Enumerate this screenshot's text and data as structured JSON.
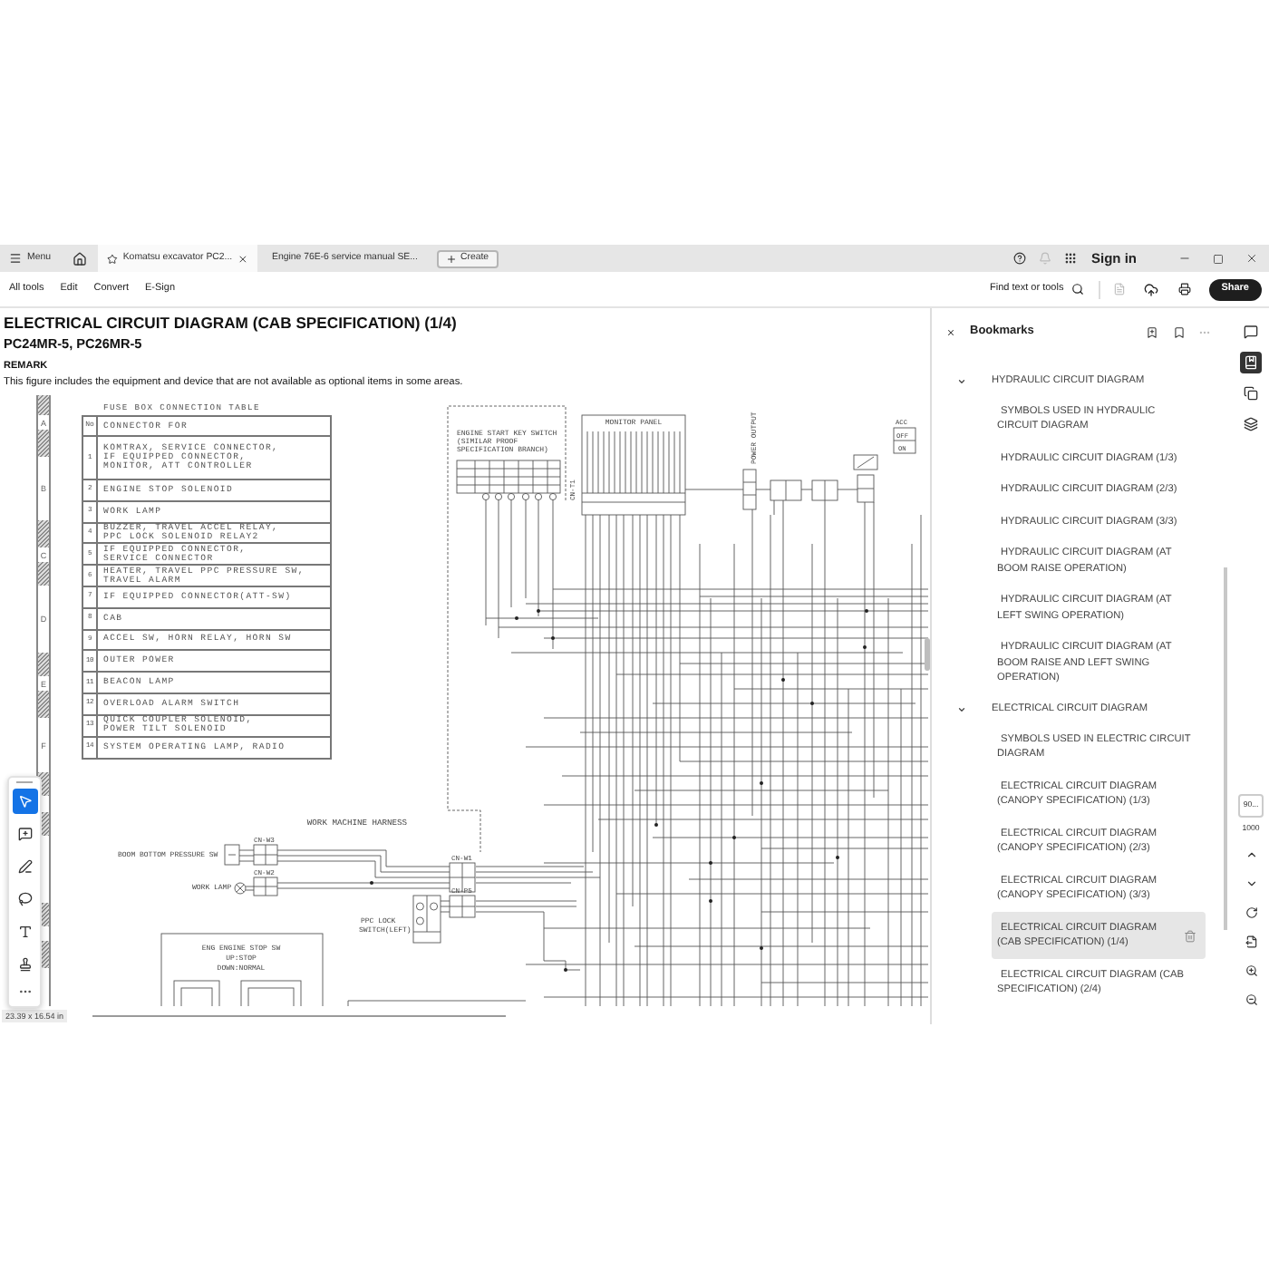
{
  "tabs_bar": {
    "menu": "Menu",
    "tabs": [
      {
        "title": "Komatsu excavator PC2...",
        "selected": true
      },
      {
        "title": "Engine 76E-6 service manual SE...",
        "selected": false
      }
    ],
    "create": "Create",
    "sign_in": "Sign in"
  },
  "toolbar": {
    "items": [
      "All tools",
      "Edit",
      "Convert",
      "E-Sign"
    ],
    "find": "Find text or tools",
    "share": "Share"
  },
  "document": {
    "title": "ELECTRICAL CIRCUIT DIAGRAM (CAB SPECIFICATION) (1/4)",
    "models": "PC24MR-5, PC26MR-5",
    "remark_heading": "REMARK",
    "remark": "This figure includes the equipment and device that are not available as optional items in some areas.",
    "zones": [
      "A",
      "B",
      "C",
      "D",
      "E",
      "F"
    ],
    "fuse_table": {
      "title": "FUSE BOX CONNECTION TABLE",
      "columns": [
        "No",
        "CONNECTOR FOR"
      ],
      "rows": [
        {
          "no": "1",
          "lines": [
            "KOMTRAX, SERVICE CONNECTOR,",
            "IF EQUIPPED CONNECTOR,",
            "MONITOR, ATT CONTROLLER"
          ]
        },
        {
          "no": "2",
          "lines": [
            "ENGINE STOP SOLENOID"
          ]
        },
        {
          "no": "3",
          "lines": [
            "WORK LAMP"
          ]
        },
        {
          "no": "4",
          "lines": [
            "BUZZER, TRAVEL ACCEL RELAY,",
            "PPC LOCK SOLENOID RELAY2"
          ]
        },
        {
          "no": "5",
          "lines": [
            "IF EQUIPPED CONNECTOR,",
            "SERVICE CONNECTOR"
          ]
        },
        {
          "no": "6",
          "lines": [
            "HEATER, TRAVEL PPC PRESSURE SW,",
            "TRAVEL ALARM"
          ]
        },
        {
          "no": "7",
          "lines": [
            "IF EQUIPPED CONNECTOR(ATT-SW)"
          ]
        },
        {
          "no": "8",
          "lines": [
            "CAB"
          ]
        },
        {
          "no": "9",
          "lines": [
            "ACCEL SW, HORN RELAY, HORN SW"
          ]
        },
        {
          "no": "10",
          "lines": [
            "OUTER POWER"
          ]
        },
        {
          "no": "11",
          "lines": [
            "BEACON LAMP"
          ]
        },
        {
          "no": "12",
          "lines": [
            "OVERLOAD ALARM SWITCH"
          ]
        },
        {
          "no": "13",
          "lines": [
            "QUICK COUPLER SOLENOID,",
            "POWER TILT SOLENOID"
          ]
        },
        {
          "no": "14",
          "lines": [
            "SYSTEM OPERATING LAMP, RADIO"
          ]
        }
      ]
    },
    "diagram": {
      "key_switch": [
        "ENGINE START KEY SWITCH",
        "(SIMILAR PROOF",
        "SPECIFICATION BRANCH)"
      ],
      "monitor_panel": "MONITOR PANEL",
      "panel_connector": "CN-T1",
      "power_output": "POWER OUTPUT",
      "key_positions": [
        "ACC",
        "OFF",
        "ON"
      ],
      "harness": "WORK MACHINE HARNESS",
      "boom_switch": "BOOM BOTTOM PRESSURE SW",
      "work_lamp": "WORK LAMP",
      "connectors": [
        "CN-W3",
        "CN-W2",
        "CN-W1",
        "CN-P5"
      ],
      "ppc_lock": [
        "PPC LOCK",
        "SWITCH(LEFT)"
      ],
      "engine_stop": [
        "ENG ENGINE STOP SW",
        "UP:STOP",
        "DOWN:NORMAL"
      ]
    }
  },
  "left_tools": [
    {
      "kind": "select",
      "selected": true
    },
    {
      "kind": "comment",
      "selected": false
    },
    {
      "kind": "draw",
      "selected": false
    },
    {
      "kind": "lasso",
      "selected": false
    },
    {
      "kind": "text",
      "selected": false
    },
    {
      "kind": "stamp",
      "selected": false
    }
  ],
  "bookmarks": {
    "title": "Bookmarks",
    "items": [
      {
        "label": "HYDRAULIC CIRCUIT DIAGRAM",
        "expanded": true,
        "children": [
          {
            "label": "SYMBOLS USED IN HYDRAULIC CIRCUIT DIAGRAM",
            "selected": false
          },
          {
            "label": "HYDRAULIC CIRCUIT DIAGRAM (1/3)",
            "selected": false
          },
          {
            "label": "HYDRAULIC CIRCUIT DIAGRAM (2/3)",
            "selected": false
          },
          {
            "label": "HYDRAULIC CIRCUIT DIAGRAM (3/3)",
            "selected": false
          },
          {
            "label": "HYDRAULIC CIRCUIT DIAGRAM (AT BOOM RAISE OPERATION)",
            "selected": false
          },
          {
            "label": "HYDRAULIC CIRCUIT DIAGRAM (AT LEFT SWING OPERATION)",
            "selected": false
          },
          {
            "label": "HYDRAULIC CIRCUIT DIAGRAM (AT BOOM RAISE AND LEFT SWING OPERATION)",
            "selected": false
          }
        ]
      },
      {
        "label": "ELECTRICAL CIRCUIT DIAGRAM",
        "expanded": true,
        "children": [
          {
            "label": "SYMBOLS USED IN ELECTRIC CIRCUIT DIAGRAM",
            "selected": false
          },
          {
            "label": "ELECTRICAL CIRCUIT DIAGRAM (CANOPY SPECIFICATION) (1/3)",
            "selected": false
          },
          {
            "label": "ELECTRICAL CIRCUIT DIAGRAM (CANOPY SPECIFICATION) (2/3)",
            "selected": false
          },
          {
            "label": "ELECTRICAL CIRCUIT DIAGRAM (CANOPY SPECIFICATION) (3/3)",
            "selected": false
          },
          {
            "label": "ELECTRICAL CIRCUIT DIAGRAM (CAB SPECIFICATION) (1/4)",
            "selected": true
          },
          {
            "label": "ELECTRICAL CIRCUIT DIAGRAM (CAB SPECIFICATION) (2/4)",
            "selected": false
          }
        ]
      }
    ]
  },
  "side_rail": [
    {
      "kind": "comments",
      "selected": false
    },
    {
      "kind": "bookmarks",
      "selected": true
    },
    {
      "kind": "pages",
      "selected": false
    },
    {
      "kind": "layers",
      "selected": false
    }
  ],
  "page_nav": {
    "page": "90...",
    "total": "1000"
  },
  "status_bar": {
    "page_size": "23.39 x 16.54 in"
  }
}
